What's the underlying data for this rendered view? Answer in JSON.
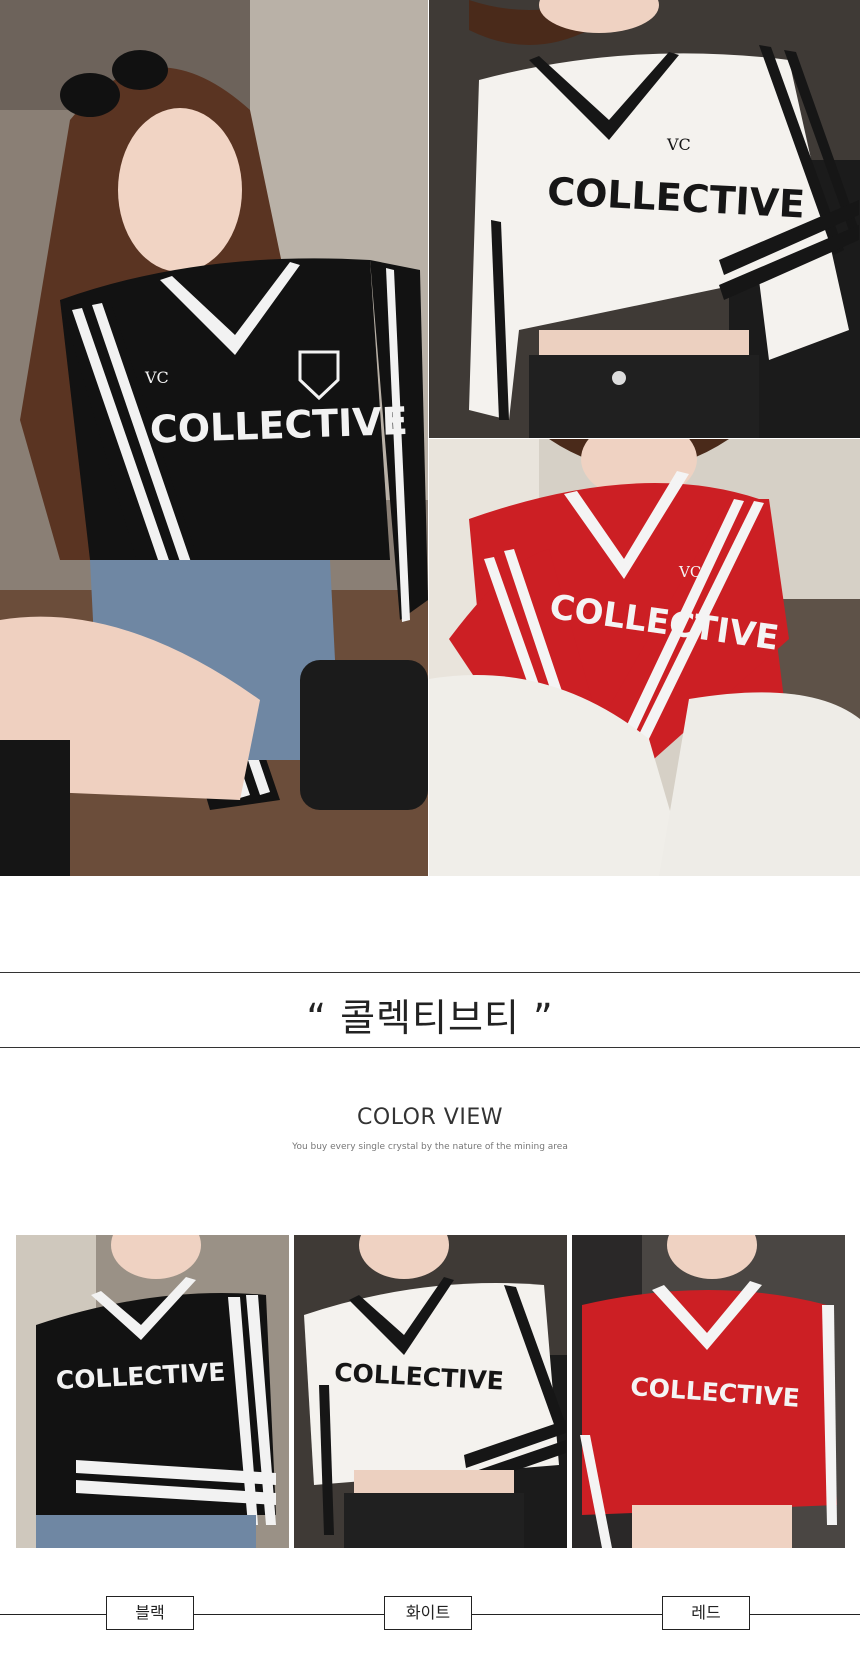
{
  "hero": {
    "photos": [
      {
        "shirt_color": "#121212",
        "trim_color": "#f2f2f2",
        "print_text": "COLLECTIVE",
        "logo_text": "VC"
      },
      {
        "shirt_color": "#f4f2ee",
        "trim_color": "#161616",
        "print_text": "COLLECTIVE",
        "logo_text": "VC"
      },
      {
        "shirt_color": "#cc1f24",
        "trim_color": "#f4f4f4",
        "print_text": "COLLECTIVE",
        "logo_text": "VC"
      }
    ]
  },
  "product": {
    "title": "“ 콜렉티브티 ”"
  },
  "color_view": {
    "heading": "COLOR VIEW",
    "subheading": "You buy every single crystal by the nature of the mining area"
  },
  "variants": [
    {
      "label": "블랙",
      "shirt_color": "#121212",
      "trim_color": "#f2f2f2"
    },
    {
      "label": "화이트",
      "shirt_color": "#f4f2ee",
      "trim_color": "#161616"
    },
    {
      "label": "레드",
      "shirt_color": "#cc1f24",
      "trim_color": "#f4f4f4"
    }
  ]
}
